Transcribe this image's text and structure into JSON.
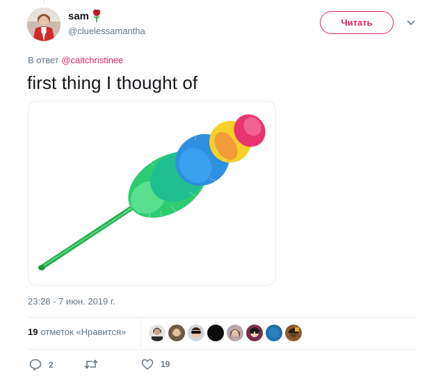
{
  "author": {
    "display_name": "sam",
    "handle": "@cluelessamantha",
    "emoji_icon": "rose-icon"
  },
  "follow_button": {
    "label": "Читать"
  },
  "reply_context": {
    "prefix": "В ответ",
    "mention": "@caitchristinee"
  },
  "tweet": {
    "text": "first thing I thought of",
    "media_icon": "feather-duster-image"
  },
  "timestamp": "23:28 - 7 июн. 2019 г.",
  "likes": {
    "count": "19",
    "label": "отметок «Нравится»",
    "liker_avatars": 8
  },
  "actions": {
    "reply": {
      "icon": "reply-icon",
      "count": "2"
    },
    "retweet": {
      "icon": "retweet-icon",
      "count": ""
    },
    "like": {
      "icon": "heart-icon",
      "count": "19"
    }
  },
  "colors": {
    "accent": "#e0245e",
    "secondary_text": "#657786",
    "primary_text": "#14171a",
    "border": "#e6ecf0"
  }
}
